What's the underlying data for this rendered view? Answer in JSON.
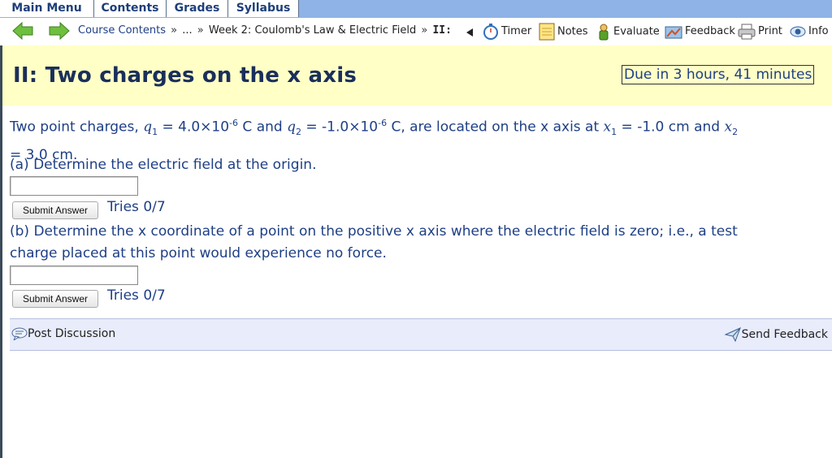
{
  "tabs": [
    {
      "label": "Main Menu"
    },
    {
      "label": "Contents"
    },
    {
      "label": "Grades"
    },
    {
      "label": "Syllabus"
    }
  ],
  "nav": {
    "course_contents": "Course Contents",
    "sep": "»",
    "ellipsis": "...",
    "week": "Week 2: Coulomb's Law & Electric Field",
    "current": "II:"
  },
  "tools": {
    "timer": "Timer",
    "notes": "Notes",
    "evaluate": "Evaluate",
    "feedback": "Feedback",
    "print": "Print",
    "info": "Info"
  },
  "page": {
    "title": "II: Two charges on the x axis",
    "due": "Due in 3 hours, 41 minutes"
  },
  "problem": {
    "intro_a": "Two point charges, ",
    "q1_sym": "q",
    "q1_sub": "1",
    "q1_val": " = 4.0×10",
    "q1_exp": "-6",
    "and_q2": " C and ",
    "q2_sym": "q",
    "q2_sub": "2",
    "q2_val": " = -1.0×10",
    "q2_exp": "-6",
    "located": " C, are located on the x axis at ",
    "x1_sym": "x",
    "x1_sub": "1",
    "x1_val": " = -1.0 cm and ",
    "x2_sym": "x",
    "x2_sub": "2",
    "x2_val": "= 3.0 cm.",
    "part_a": "(a) Determine the electric field at the origin.",
    "part_b_1": "(b) Determine the x coordinate of a point on the positive x axis where the electric field is zero; i.e., a test",
    "part_b_2": "charge placed at this point would experience no force."
  },
  "answers": {
    "a_value": "",
    "b_value": ""
  },
  "buttons": {
    "submit_a": "Submit Answer",
    "submit_b": "Submit Answer"
  },
  "tries": {
    "a": "Tries 0/7",
    "b": "Tries 0/7"
  },
  "discussion": {
    "post": "Post Discussion",
    "send_feedback": "Send Feedback"
  },
  "colors": {
    "tab_bar": "#8fb3e6",
    "title_band": "#ffffc6",
    "text_blue": "#1e3f86",
    "discussion_bar": "#e8ecfb"
  }
}
